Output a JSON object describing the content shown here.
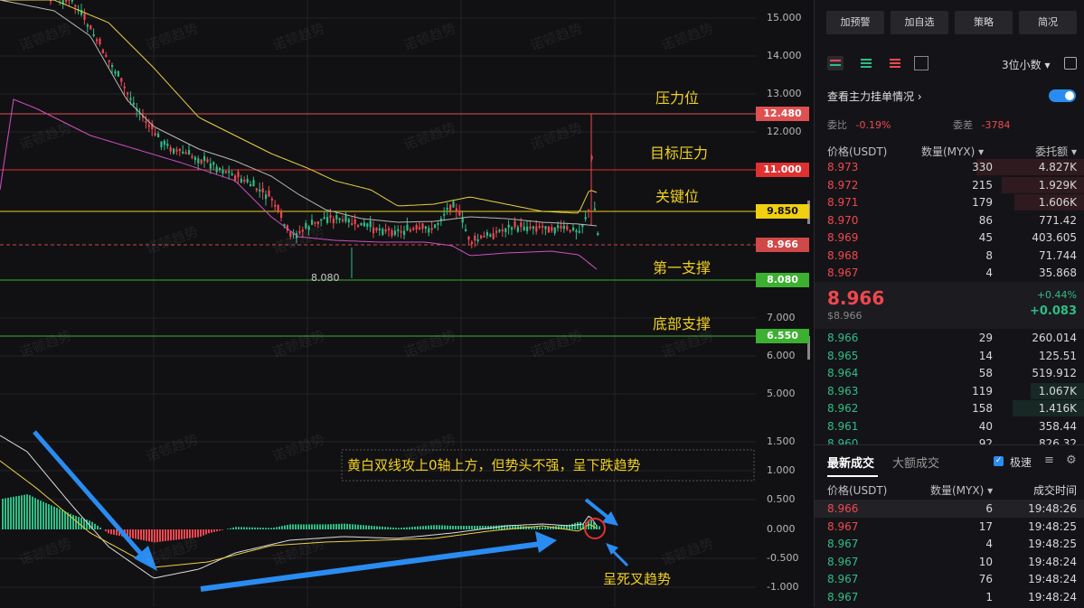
{
  "chart": {
    "y_axis_labels": [
      "15.000",
      "14.000",
      "13.000",
      "12.000",
      "7.000",
      "6.000",
      "5.000"
    ],
    "macd_axis_labels": [
      "1.500",
      "1.000",
      "0.500",
      "0.000",
      "-0.500",
      "-1.000"
    ],
    "price_tags": [
      {
        "label": "12.480",
        "bg": "#e05050",
        "fg": "#ffffff"
      },
      {
        "label": "11.000",
        "bg": "#e03030",
        "fg": "#ffffff"
      },
      {
        "label": "9.850",
        "bg": "#f0d010",
        "fg": "#111111"
      },
      {
        "label": "8.966",
        "bg": "#d04848",
        "fg": "#ffffff"
      },
      {
        "label": "8.080",
        "bg": "#3cb030",
        "fg": "#ffffff"
      },
      {
        "label": "6.550",
        "bg": "#3cb030",
        "fg": "#ffffff"
      }
    ],
    "low_marker": "8.080",
    "annotations": {
      "pressure": "压力位",
      "target_pressure": "目标压力",
      "key_level": "关键位",
      "first_support": "第一支撑",
      "bottom_support": "底部支撑",
      "macd_note": "黄白双线攻上0轴上方，但势头不强，呈下跌趋势",
      "death_cross": "呈死叉趋势"
    },
    "watermark": "诺顿趋势",
    "colors": {
      "red": "#f0474f",
      "green": "#2ebd85",
      "yellow": "#f0d020",
      "accent": "#2a8cf0"
    }
  },
  "panel": {
    "buttons": [
      "加预警",
      "加自选",
      "策略",
      "简况"
    ],
    "decimal_select": "3位小数",
    "main_order_link": "查看主力挂单情况",
    "ratio_label": "委比",
    "ratio_value": "-0.19%",
    "diff_label": "委差",
    "diff_value": "-3784",
    "orderbook_headers": [
      "价格(USDT)",
      "数量(MYX)",
      "委托额"
    ],
    "asks": [
      {
        "price": "8.973",
        "qty": "330",
        "amount": "4.827K"
      },
      {
        "price": "8.972",
        "qty": "215",
        "amount": "1.929K"
      },
      {
        "price": "8.971",
        "qty": "179",
        "amount": "1.606K"
      },
      {
        "price": "8.970",
        "qty": "86",
        "amount": "771.42"
      },
      {
        "price": "8.969",
        "qty": "45",
        "amount": "403.605"
      },
      {
        "price": "8.968",
        "qty": "8",
        "amount": "71.744"
      },
      {
        "price": "8.967",
        "qty": "4",
        "amount": "35.868"
      }
    ],
    "last_price": "8.966",
    "mark_price": "$8.966",
    "change_pct": "+0.44%",
    "change_abs": "+0.083",
    "bids": [
      {
        "price": "8.966",
        "qty": "29",
        "amount": "260.014"
      },
      {
        "price": "8.965",
        "qty": "14",
        "amount": "125.51"
      },
      {
        "price": "8.964",
        "qty": "58",
        "amount": "519.912"
      },
      {
        "price": "8.963",
        "qty": "119",
        "amount": "1.067K"
      },
      {
        "price": "8.962",
        "qty": "158",
        "amount": "1.416K"
      },
      {
        "price": "8.961",
        "qty": "40",
        "amount": "358.44"
      },
      {
        "price": "8.960",
        "qty": "92",
        "amount": "826.32"
      }
    ],
    "trades_tab_latest": "最新成交",
    "trades_tab_large": "大额成交",
    "fast_label": "极速",
    "trades_headers": [
      "价格(USDT)",
      "数量(MYX)",
      "成交时间"
    ],
    "trades": [
      {
        "price": "8.966",
        "qty": "6",
        "time": "19:48:26",
        "side": "red"
      },
      {
        "price": "8.967",
        "qty": "17",
        "time": "19:48:25",
        "side": "red"
      },
      {
        "price": "8.967",
        "qty": "4",
        "time": "19:48:25",
        "side": "green"
      },
      {
        "price": "8.967",
        "qty": "10",
        "time": "19:48:24",
        "side": "green"
      },
      {
        "price": "8.967",
        "qty": "76",
        "time": "19:48:24",
        "side": "green"
      },
      {
        "price": "8.967",
        "qty": "1",
        "time": "19:48:24",
        "side": "green"
      }
    ]
  }
}
